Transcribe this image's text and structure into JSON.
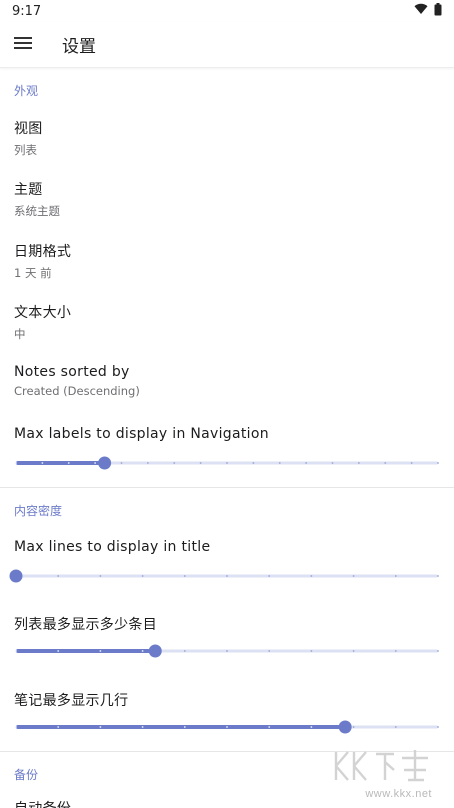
{
  "status_bar": {
    "time": "9:17",
    "icons": [
      "wifi-icon",
      "battery-icon"
    ]
  },
  "app_bar": {
    "title": "设置",
    "menu_icon": "hamburger-menu-icon"
  },
  "sections": {
    "appearance": {
      "header": "外观",
      "items": [
        {
          "title": "视图",
          "subtitle": "列表"
        },
        {
          "title": "主题",
          "subtitle": "系统主题"
        },
        {
          "title": "日期格式",
          "subtitle": "1 天 前"
        },
        {
          "title": "文本大小",
          "subtitle": "中"
        },
        {
          "title": "Notes sorted by",
          "subtitle": "Created (Descending)"
        }
      ],
      "labels_slider": {
        "title": "Max labels to display in Navigation",
        "value_fraction": 0.21,
        "ticks": 16
      }
    },
    "density": {
      "header": "内容密度",
      "title_lines_slider": {
        "title": "Max lines to display in title",
        "value_fraction": 0.0,
        "ticks": 10
      },
      "list_items_slider": {
        "title": "列表最多显示多少条目",
        "value_fraction": 0.33,
        "ticks": 10
      },
      "note_lines_slider": {
        "title": "笔记最多显示几行",
        "value_fraction": 0.78,
        "ticks": 10
      }
    },
    "backup": {
      "header": "备份",
      "first_item": "自动备份"
    }
  },
  "colors": {
    "accent": "#6b7bc9",
    "track_inactive": "#dce1f3",
    "track_active": "#6b7bc9"
  },
  "watermark": {
    "text": "www.kkx.net",
    "logo": "kk-download-logo"
  }
}
